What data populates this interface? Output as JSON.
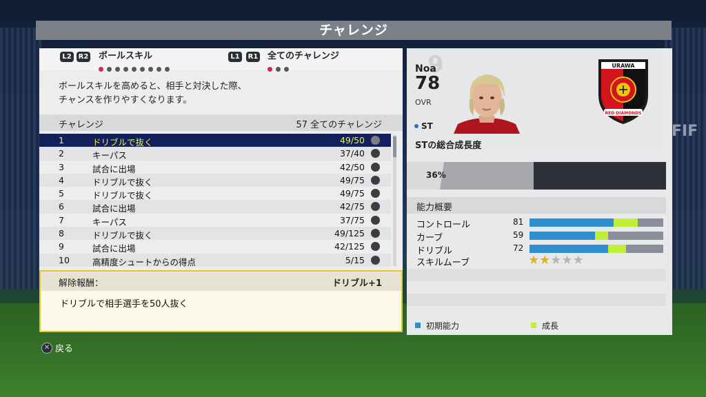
{
  "title": "チャレンジ",
  "category": {
    "left_buttons": [
      "L2",
      "R2"
    ],
    "left_label": "ボールスキル",
    "left_dots_total": 9,
    "left_dots_active": 1,
    "right_buttons": [
      "L1",
      "R1"
    ],
    "right_label": "全てのチャレンジ",
    "right_dots_total": 3,
    "right_dots_active": 1
  },
  "description_line1": "ボールスキルを高めると、相手と対決した際、",
  "description_line2": "チャンスを作りやすくなります。",
  "list_header": {
    "label": "チャレンジ",
    "count": "57 全てのチャレンジ"
  },
  "challenges": [
    {
      "num": "1",
      "name": "ドリブルで抜く",
      "progress": "49/50"
    },
    {
      "num": "2",
      "name": "キーパス",
      "progress": "37/40"
    },
    {
      "num": "3",
      "name": "試合に出場",
      "progress": "42/50"
    },
    {
      "num": "4",
      "name": "ドリブルで抜く",
      "progress": "49/75"
    },
    {
      "num": "5",
      "name": "ドリブルで抜く",
      "progress": "49/75"
    },
    {
      "num": "6",
      "name": "試合に出場",
      "progress": "42/75"
    },
    {
      "num": "7",
      "name": "キーパス",
      "progress": "37/75"
    },
    {
      "num": "8",
      "name": "ドリブルで抜く",
      "progress": "49/125"
    },
    {
      "num": "9",
      "name": "試合に出場",
      "progress": "42/125"
    },
    {
      "num": "10",
      "name": "高精度シュートからの得点",
      "progress": "5/15"
    }
  ],
  "reward": {
    "label": "解除報酬：",
    "value": "ドリブル+1",
    "text": "ドリブルで相手選手を50人抜く"
  },
  "player": {
    "ghost_number": "9",
    "name": "Noa",
    "ovr": "78",
    "ovr_label": "OVR",
    "position": "ST",
    "growth_label": "STの総合成長度"
  },
  "club_badge": {
    "top_text": "URAWA",
    "bottom_text": "RED DIAMONDS",
    "primary_color": "#d4141c"
  },
  "growth": {
    "percent_label": "36%",
    "percent": 36,
    "bar_fill_percent": 49
  },
  "abilities": {
    "header": "能力概要",
    "stats": [
      {
        "name": "コントロール",
        "value": "81",
        "base_fraction": 0.63,
        "growth_fraction": 0.18
      },
      {
        "name": "カーブ",
        "value": "59",
        "base_fraction": 0.49,
        "growth_fraction": 0.1
      },
      {
        "name": "ドリブル",
        "value": "72",
        "base_fraction": 0.59,
        "growth_fraction": 0.13
      }
    ],
    "skill_moves_label": "スキルムーブ",
    "skill_moves_stars": 2,
    "skill_moves_max": 5
  },
  "legend": {
    "base_label": "初期能力",
    "base_color": "#2e8ed0",
    "growth_label": "成長",
    "growth_color": "#c0ef3a"
  },
  "footer": {
    "back_label": "戻る",
    "back_icon": "cross-button-icon"
  },
  "colors": {
    "selected_row_bg": "#13205a",
    "selected_row_text": "#e9f54a",
    "reward_border": "#e8c630"
  }
}
